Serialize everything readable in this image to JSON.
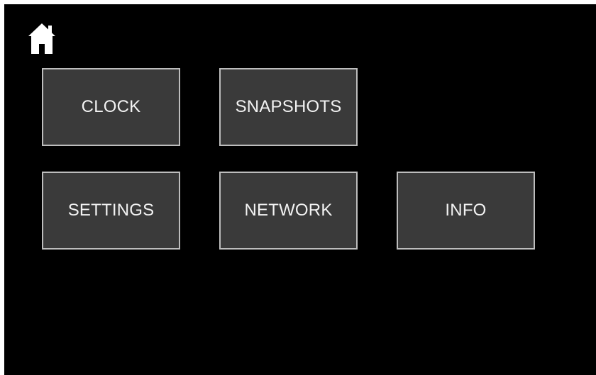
{
  "icons": {
    "home": "home-icon"
  },
  "colors": {
    "background": "#000000",
    "tile_fill": "#3a3a3a",
    "tile_border": "#bdbdbd",
    "tile_text": "#f2f2f2",
    "icon": "#ffffff"
  },
  "menu": {
    "clock_label": "CLOCK",
    "snapshots_label": "SNAPSHOTS",
    "settings_label": "SETTINGS",
    "network_label": "NETWORK",
    "info_label": "INFO"
  }
}
